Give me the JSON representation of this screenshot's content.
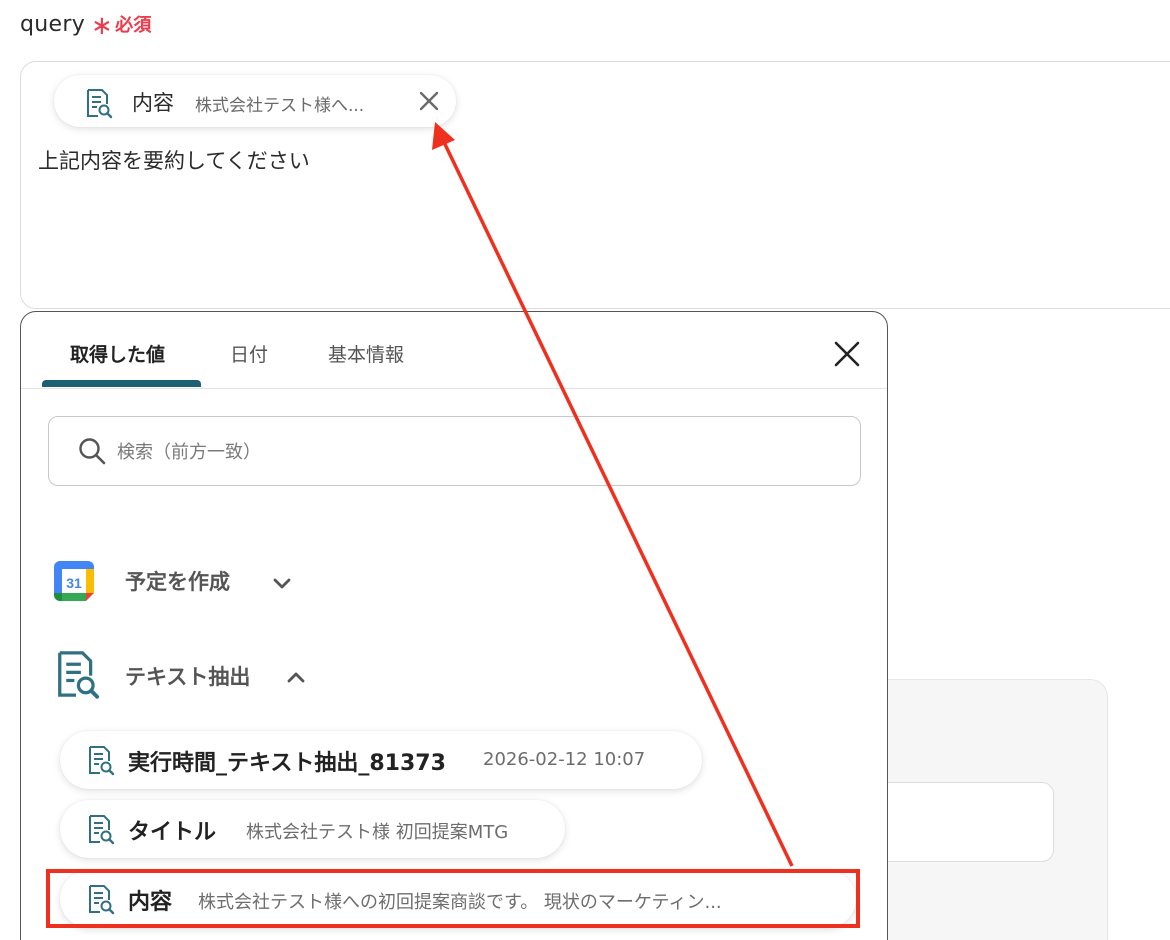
{
  "field": {
    "label": "query",
    "asterisk": "∗",
    "required": "必須"
  },
  "query": {
    "text": "上記内容を要約してください"
  },
  "chip": {
    "name": "内容",
    "value": "株式会社テスト様へ..."
  },
  "picker": {
    "tabs": [
      {
        "label": "取得した値"
      },
      {
        "label": "日付"
      },
      {
        "label": "基本情報"
      }
    ],
    "search_placeholder": "検索（前方一致）",
    "groups": [
      {
        "label": "予定を作成",
        "icon": "google-calendar-icon",
        "calendar_day": "31",
        "expanded": false
      },
      {
        "label": "テキスト抽出",
        "icon": "text-extract-icon",
        "expanded": true
      }
    ],
    "items": [
      {
        "name": "実行時間_テキスト抽出_81373",
        "value": "2026-02-12 10:07"
      },
      {
        "name": "タイトル",
        "value": "株式会社テスト様 初回提案MTG"
      },
      {
        "name": "内容",
        "value": "株式会社テスト様への初回提案商談です。 現状のマーケティン..."
      }
    ]
  },
  "colors": {
    "accent": "#1f5f73",
    "annotation": "#f0301e",
    "required": "#ee3b4b"
  }
}
